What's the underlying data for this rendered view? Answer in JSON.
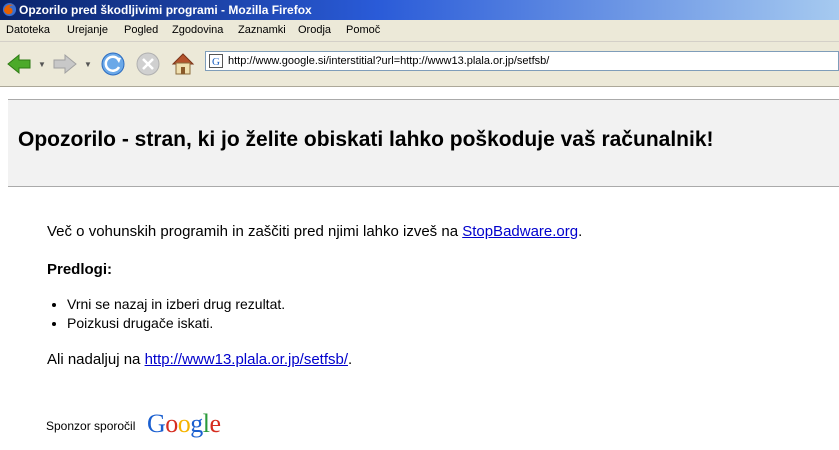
{
  "window": {
    "title": "Opzorilo pred škodljivimi programi - Mozilla Firefox"
  },
  "menu": [
    "Datoteka",
    "Urejanje",
    "Pogled",
    "Zgodovina",
    "Zaznamki",
    "Orodja",
    "Pomoč"
  ],
  "toolbar": {
    "url": "http://www.google.si/interstitial?url=http://www13.plala.or.jp/setfsb/"
  },
  "icons": {
    "back": "back-arrow-icon",
    "forward": "forward-arrow-icon",
    "reload": "reload-icon",
    "stop": "stop-icon",
    "home": "home-icon",
    "site": "google-g-icon"
  },
  "page": {
    "heading": "Opozorilo - stran, ki jo želite obiskati lahko poškoduje vaš računalnik!",
    "info_prefix": "Več o vohunskih programih in zaščiti pred njimi lahko izveš na ",
    "info_link": "StopBadware.org",
    "info_suffix": ".",
    "suggestions_title": "Predlogi:",
    "suggestions": [
      "Vrni se nazaj in izberi drug rezultat.",
      "Poizkusi drugače iskati."
    ],
    "continue_prefix": "Ali nadaljuj na ",
    "continue_link": "http://www13.plala.or.jp/setfsb/",
    "continue_suffix": ".",
    "sponsor": "Sponzor sporočil",
    "google_logo": "Google"
  },
  "colors": {
    "link": "#0000cc",
    "warn_bg": "#f2f2f2",
    "titlebar": "#0a246a"
  }
}
